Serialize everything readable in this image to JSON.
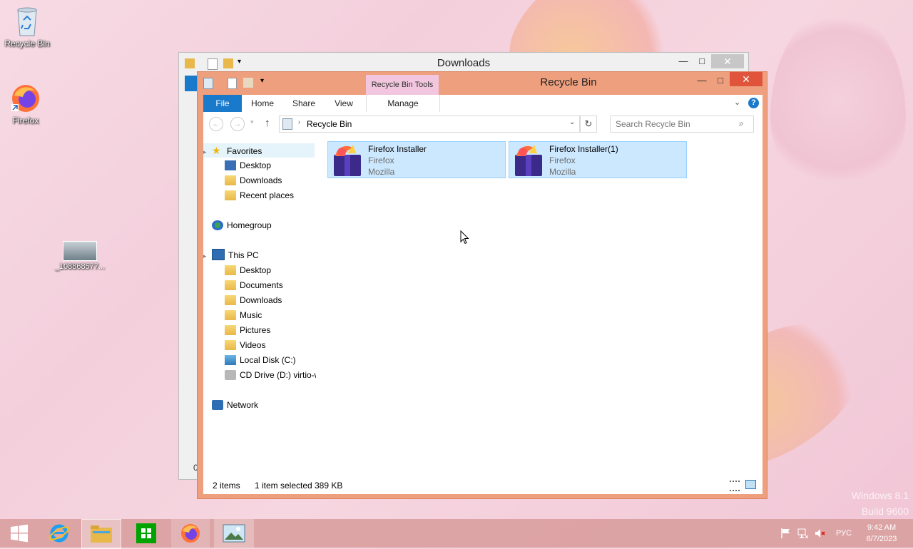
{
  "desktop": {
    "icons": [
      {
        "label": "Recycle Bin",
        "icon": "recycle-bin-icon"
      },
      {
        "label": "Firefox",
        "icon": "firefox-icon"
      },
      {
        "label": "_108868577...",
        "icon": "image-file-icon"
      }
    ],
    "watermark": [
      "Windows 8.1",
      "Build 9600"
    ]
  },
  "back_window": {
    "title": "Downloads",
    "partial_text": "0"
  },
  "window": {
    "title": "Recycle Bin",
    "contextual_tab_group": "Recycle Bin Tools",
    "tabs": [
      "File",
      "Home",
      "Share",
      "View",
      "Manage"
    ],
    "address_path": "Recycle Bin",
    "search_placeholder": "Search Recycle Bin",
    "nav": {
      "favorites": {
        "label": "Favorites",
        "items": [
          "Desktop",
          "Downloads",
          "Recent places"
        ]
      },
      "homegroup": "Homegroup",
      "this_pc": {
        "label": "This PC",
        "items": [
          "Desktop",
          "Documents",
          "Downloads",
          "Music",
          "Pictures",
          "Videos",
          "Local Disk (C:)",
          "CD Drive (D:) virtio-w"
        ]
      },
      "network": "Network"
    },
    "files": [
      {
        "name": "Firefox Installer",
        "line2": "Firefox",
        "line3": "Mozilla"
      },
      {
        "name": "Firefox Installer(1)",
        "line2": "Firefox",
        "line3": "Mozilla"
      }
    ],
    "status": {
      "count": "2 items",
      "selection": "1 item selected",
      "size": "389 KB"
    }
  },
  "tray": {
    "language": "РУС",
    "time": "9:42 AM",
    "date": "6/7/2023"
  },
  "colors": {
    "window_accent": "#ee9f7d",
    "selection": "#cce8ff",
    "file_tab": "#1979ca",
    "taskbar": "#daa0a0"
  }
}
